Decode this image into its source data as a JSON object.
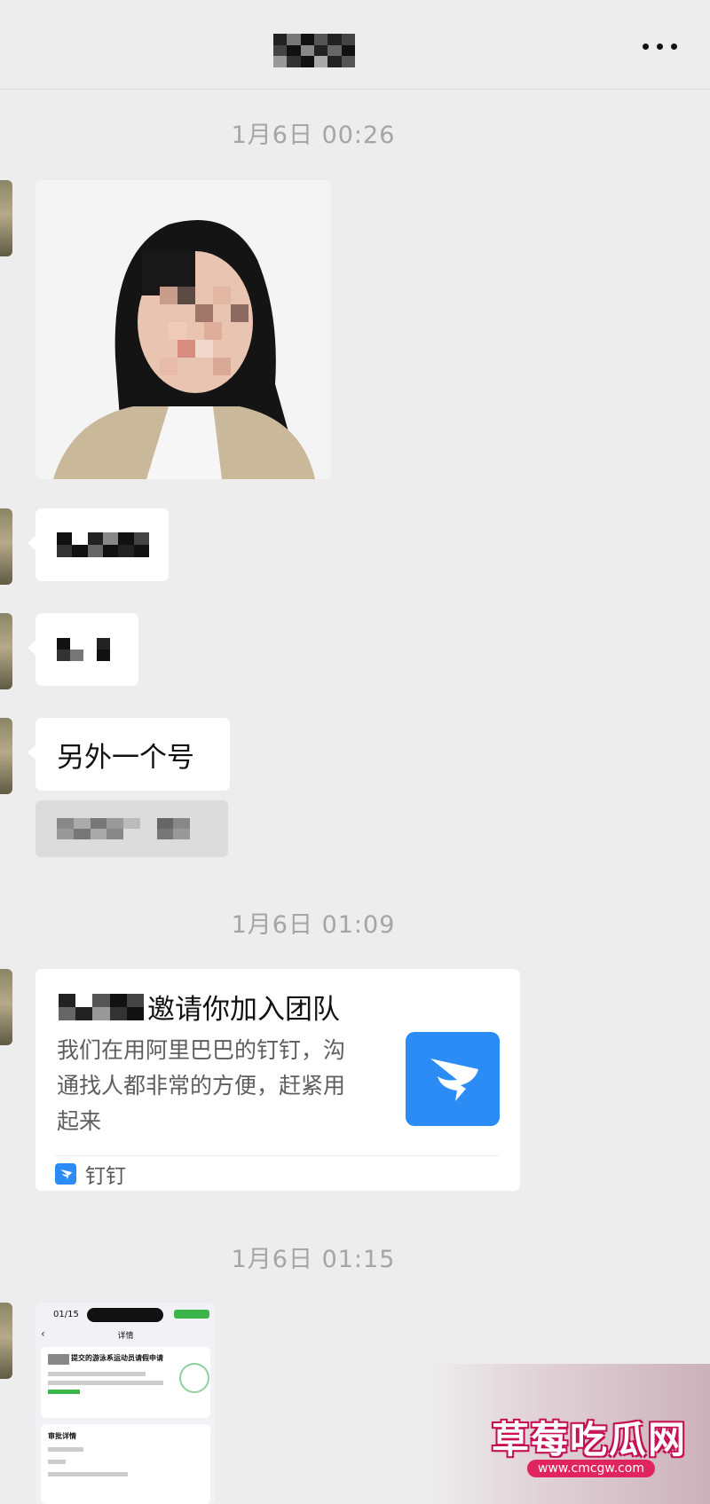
{
  "header": {
    "title_redacted": true,
    "more_icon": "more-dots-icon"
  },
  "timestamps": [
    "1月6日 00:26",
    "1月6日 01:09",
    "1月6日 01:15"
  ],
  "messages": {
    "photo": {
      "type": "image",
      "desc_icon": "portrait-photo"
    },
    "redacted_1": {
      "type": "text",
      "text": ""
    },
    "redacted_2": {
      "type": "text",
      "text": ""
    },
    "another_account": {
      "type": "text",
      "text": "另外一个号"
    }
  },
  "invite": {
    "title_suffix": "邀请你加入团队",
    "description": "我们在用阿里巴巴的钉钉，沟通找人都非常的方便，赶紧用起来",
    "source": "钉钉",
    "logo_icon": "dingtalk-logo-icon"
  },
  "screenshot_card": {
    "status_time": "01/15",
    "nav_title": "详情",
    "title": "提交的游泳系运动员请假申请",
    "section": "审批详情"
  },
  "watermark": {
    "text": "草莓吃瓜网",
    "url": "www.cmcgw.com"
  },
  "colors": {
    "background": "#ededed",
    "bubble": "#ffffff",
    "timestamp": "#a5a5a5",
    "dingtalk_blue": "#2b8cf6",
    "watermark_red": "#e0245e"
  }
}
